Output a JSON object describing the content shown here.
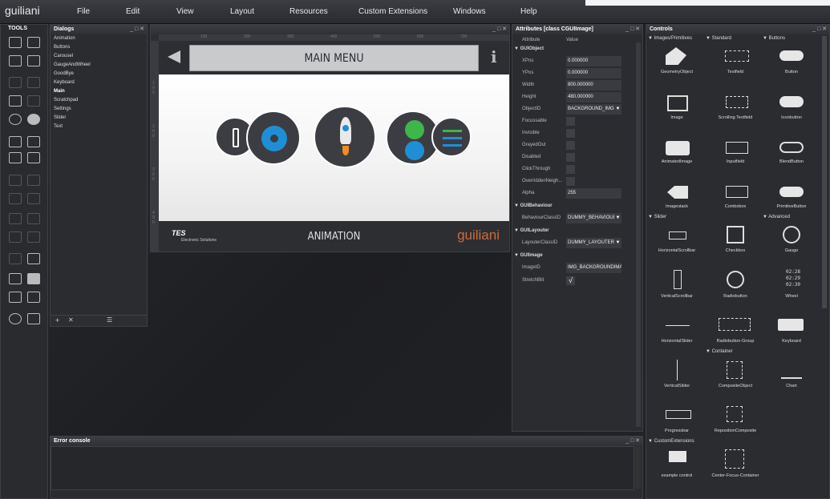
{
  "app": {
    "logo": "guiliani"
  },
  "menu": [
    "File",
    "Edit",
    "View",
    "Layout",
    "Resources",
    "Custom Extensions",
    "Windows",
    "Help"
  ],
  "tools": {
    "title": "TOOLS"
  },
  "dialogs": {
    "title": "Dialogs",
    "items": [
      "Animation",
      "Buttons",
      "Carousel",
      "GaugeAndWheel",
      "GoodBye",
      "Keyboard",
      "Main",
      "Scratchpad",
      "Settings",
      "Slider",
      "Text"
    ],
    "selected": "Main",
    "footer": {
      "add": "+",
      "remove": "✕",
      "list": "☰"
    }
  },
  "window_controls": "_ □ ✕",
  "canvas": {
    "ruler": [
      "100",
      "200",
      "300",
      "400",
      "500",
      "600",
      "700"
    ],
    "vruler": [
      "1 0 0",
      "2 0 0",
      "3 0 0",
      "4 0 0"
    ],
    "title": "MAIN MENU",
    "info": "i",
    "bottom_label": "ANIMATION",
    "tes": "TES",
    "tes_sub": "Electronic Solutions",
    "brand": "guiliani"
  },
  "attributes": {
    "title": "Attributes  [class CGUIImage]",
    "header": {
      "name": "Attribute",
      "value": "Value"
    },
    "sections": {
      "obj": "GUIObject",
      "beh": "GUIBehaviour",
      "lay": "GUILayouter",
      "img": "GUIImage"
    },
    "rows": {
      "xpos": {
        "name": "XPos",
        "value": "0.000000"
      },
      "ypos": {
        "name": "YPos",
        "value": "0.000000"
      },
      "width": {
        "name": "Width",
        "value": "800.000000"
      },
      "height": {
        "name": "Height",
        "value": "480.000000"
      },
      "objectid": {
        "name": "ObjectID",
        "value": "BACKGROUND_IMG"
      },
      "focussable": {
        "name": "Focussable"
      },
      "invisible": {
        "name": "Invisible"
      },
      "grayedout": {
        "name": "GrayedOut"
      },
      "disabled": {
        "name": "Disabled"
      },
      "clickthrough": {
        "name": "ClickThrough"
      },
      "overridden": {
        "name": "OverriddenNeigh..."
      },
      "alpha": {
        "name": "Alpha",
        "value": "255"
      },
      "behaviour": {
        "name": "BehaviourClassID",
        "value": "DUMMY_BEHAVIOUR"
      },
      "layouter": {
        "name": "LayouterClassID",
        "value": "DUMMY_LAYOUTER"
      },
      "imageid": {
        "name": "ImageID",
        "value": "IMG_BACKGROUNDIMA..."
      },
      "stretchblit": {
        "name": "StretchBlit",
        "value": "√"
      }
    },
    "dropdown_arrow": "▼"
  },
  "controls": {
    "title": "Controls",
    "categories": {
      "images": "▼ Images/Primitives",
      "standard": "▼ Standard",
      "buttons": "▼ Buttons",
      "slider": "▼ Slider",
      "advanced": "▼ Advanced",
      "container": "▼ Container",
      "custom": "▼ CustomExtensions"
    },
    "items": {
      "geometry": "GeometryObject",
      "textfield": "Textfield",
      "button": "Button",
      "image": "Image",
      "scrolling": "Scrolling Textfield",
      "iconbutton": "Iconbutton",
      "animated": "AnimatedImage",
      "inputfield": "Inputfield",
      "blend": "BlendButton",
      "imagestack": "Imagestack",
      "combobox": "Combobox",
      "primitive": "PrimitiveButton",
      "hscroll": "HorizontalScrollbar",
      "checkbox": "Checkbox",
      "gauge": "Gauge",
      "vscroll": "VerticalScrollbar",
      "radio": "Radiobutton",
      "wheel": "Wheel",
      "hslider": "HorizontalSlider",
      "radiogroup": "Radiobutton-Group",
      "keyboard": "Keyboard",
      "vslider": "VerticalSlider",
      "composite": "CompositeObject",
      "chart": "Chart",
      "progress": "Progressbar",
      "reposition": "RepositionComposite",
      "example": "example control",
      "centerfocus": "Center-Focus-Container"
    },
    "wheel_values": [
      "02:28",
      "02:29",
      "02:30"
    ]
  },
  "error_console": {
    "title": "Error console",
    "content": ""
  }
}
